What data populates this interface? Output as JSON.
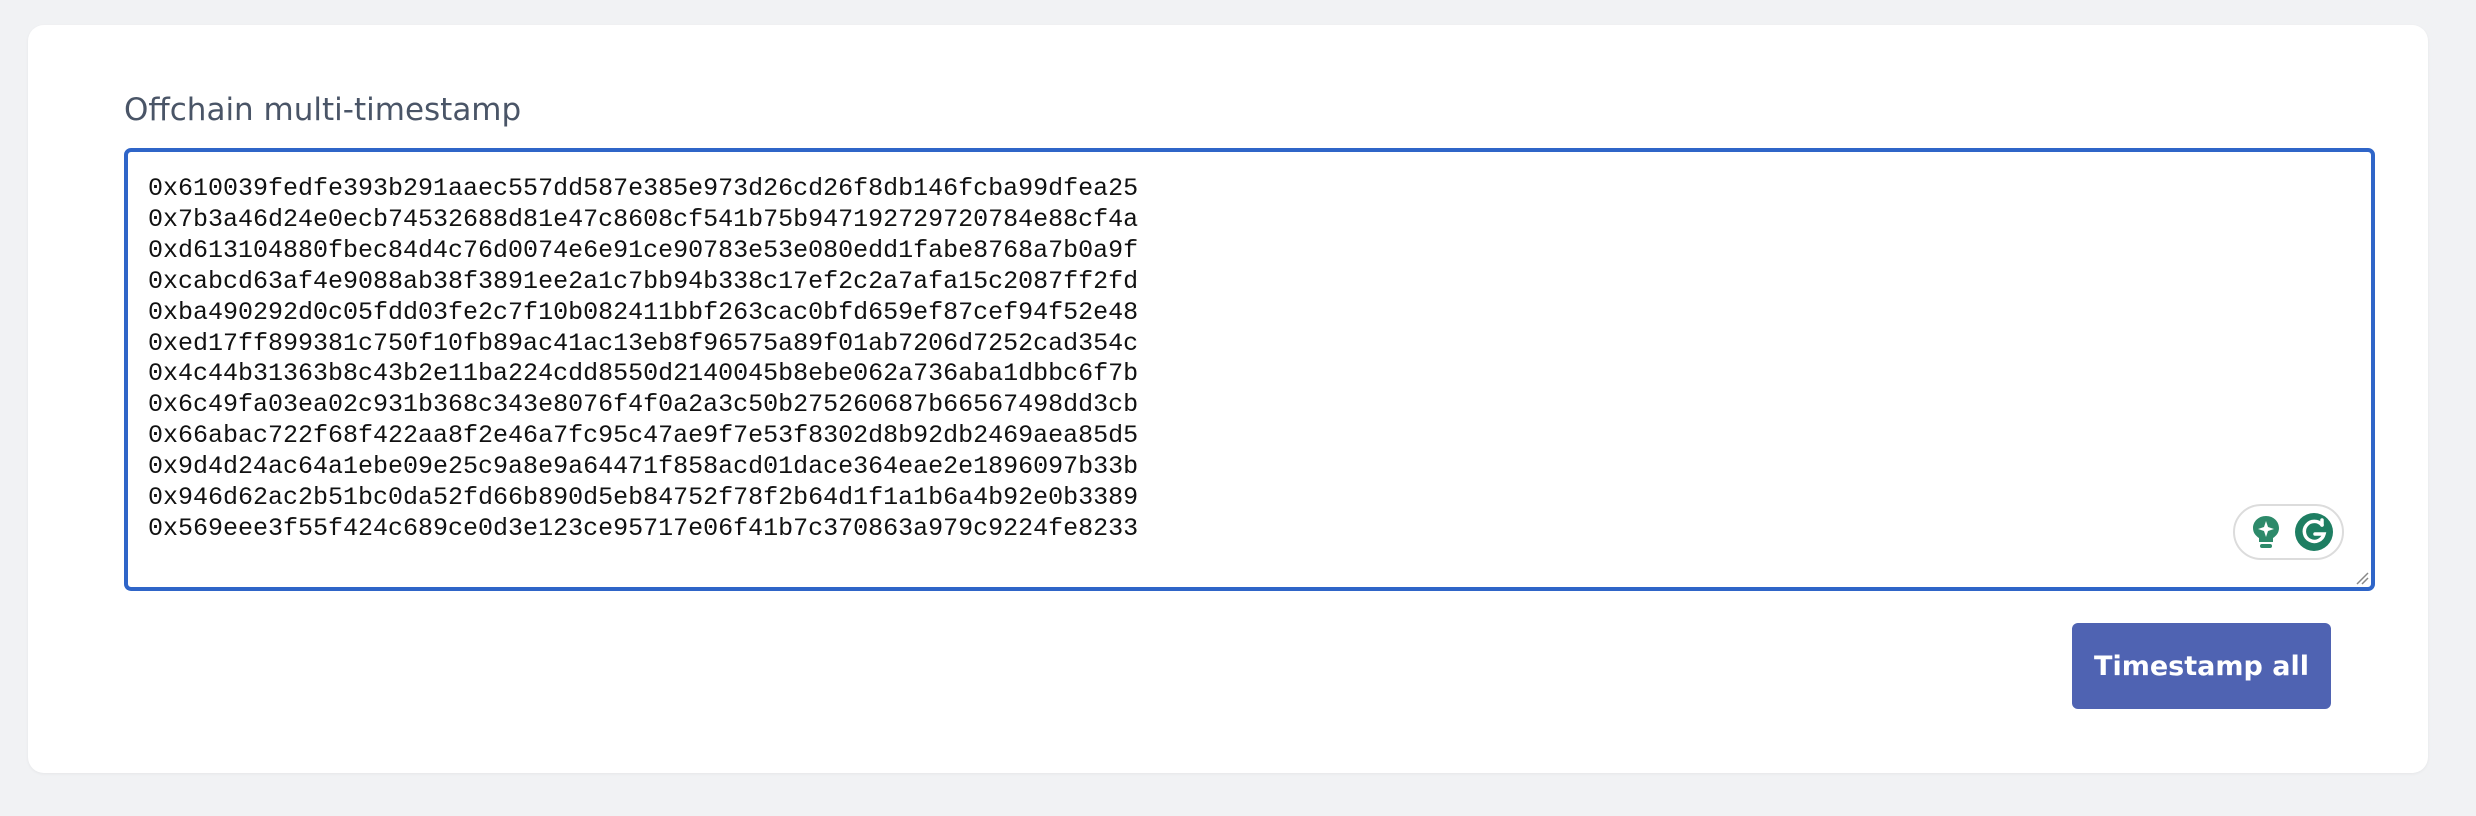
{
  "form": {
    "label": "Offchain multi-timestamp",
    "hashes": [
      "0x610039fedfe393b291aaec557dd587e385e973d26cd26f8db146fcba99dfea25",
      "0x7b3a46d24e0ecb74532688d81e47c8608cf541b75b947192729720784e88cf4a",
      "0xd613104880fbec84d4c76d0074e6e91ce90783e53e080edd1fabe8768a7b0a9f",
      "0xcabcd63af4e9088ab38f3891ee2a1c7bb94b338c17ef2c2a7afa15c2087ff2fd",
      "0xba490292d0c05fdd03fe2c7f10b082411bbf263cac0bfd659ef87cef94f52e48",
      "0xed17ff899381c750f10fb89ac41ac13eb8f96575a89f01ab7206d7252cad354c",
      "0x4c44b31363b8c43b2e11ba224cdd8550d2140045b8ebe062a736aba1dbbc6f7b",
      "0x6c49fa03ea02c931b368c343e8076f4f0a2a3c50b275260687b66567498dd3cb",
      "0x66abac722f68f422aa8f2e46a7fc95c47ae9f7e53f8302d8b92db2469aea85d5",
      "0x9d4d24ac64a1ebe09e25c9a8e9a64471f858acd01dace364eae2e1896097b33b",
      "0x946d62ac2b51bc0da52fd66b890d5eb84752f78f2b64d1f1a1b6a4b92e0b3389",
      "0x569eee3f55f424c689ce0d3e123ce95717e06f41b7c370863a979c9224fe8233"
    ],
    "submit_label": "Timestamp all"
  },
  "assistant": {
    "icons": [
      "lightbulb-sparkle-icon",
      "grammarly-g-icon"
    ]
  },
  "colors": {
    "accent_border": "#2f65c8",
    "button_bg": "#4f63b2",
    "label_text": "#4a5567",
    "page_bg": "#f1f2f4"
  }
}
